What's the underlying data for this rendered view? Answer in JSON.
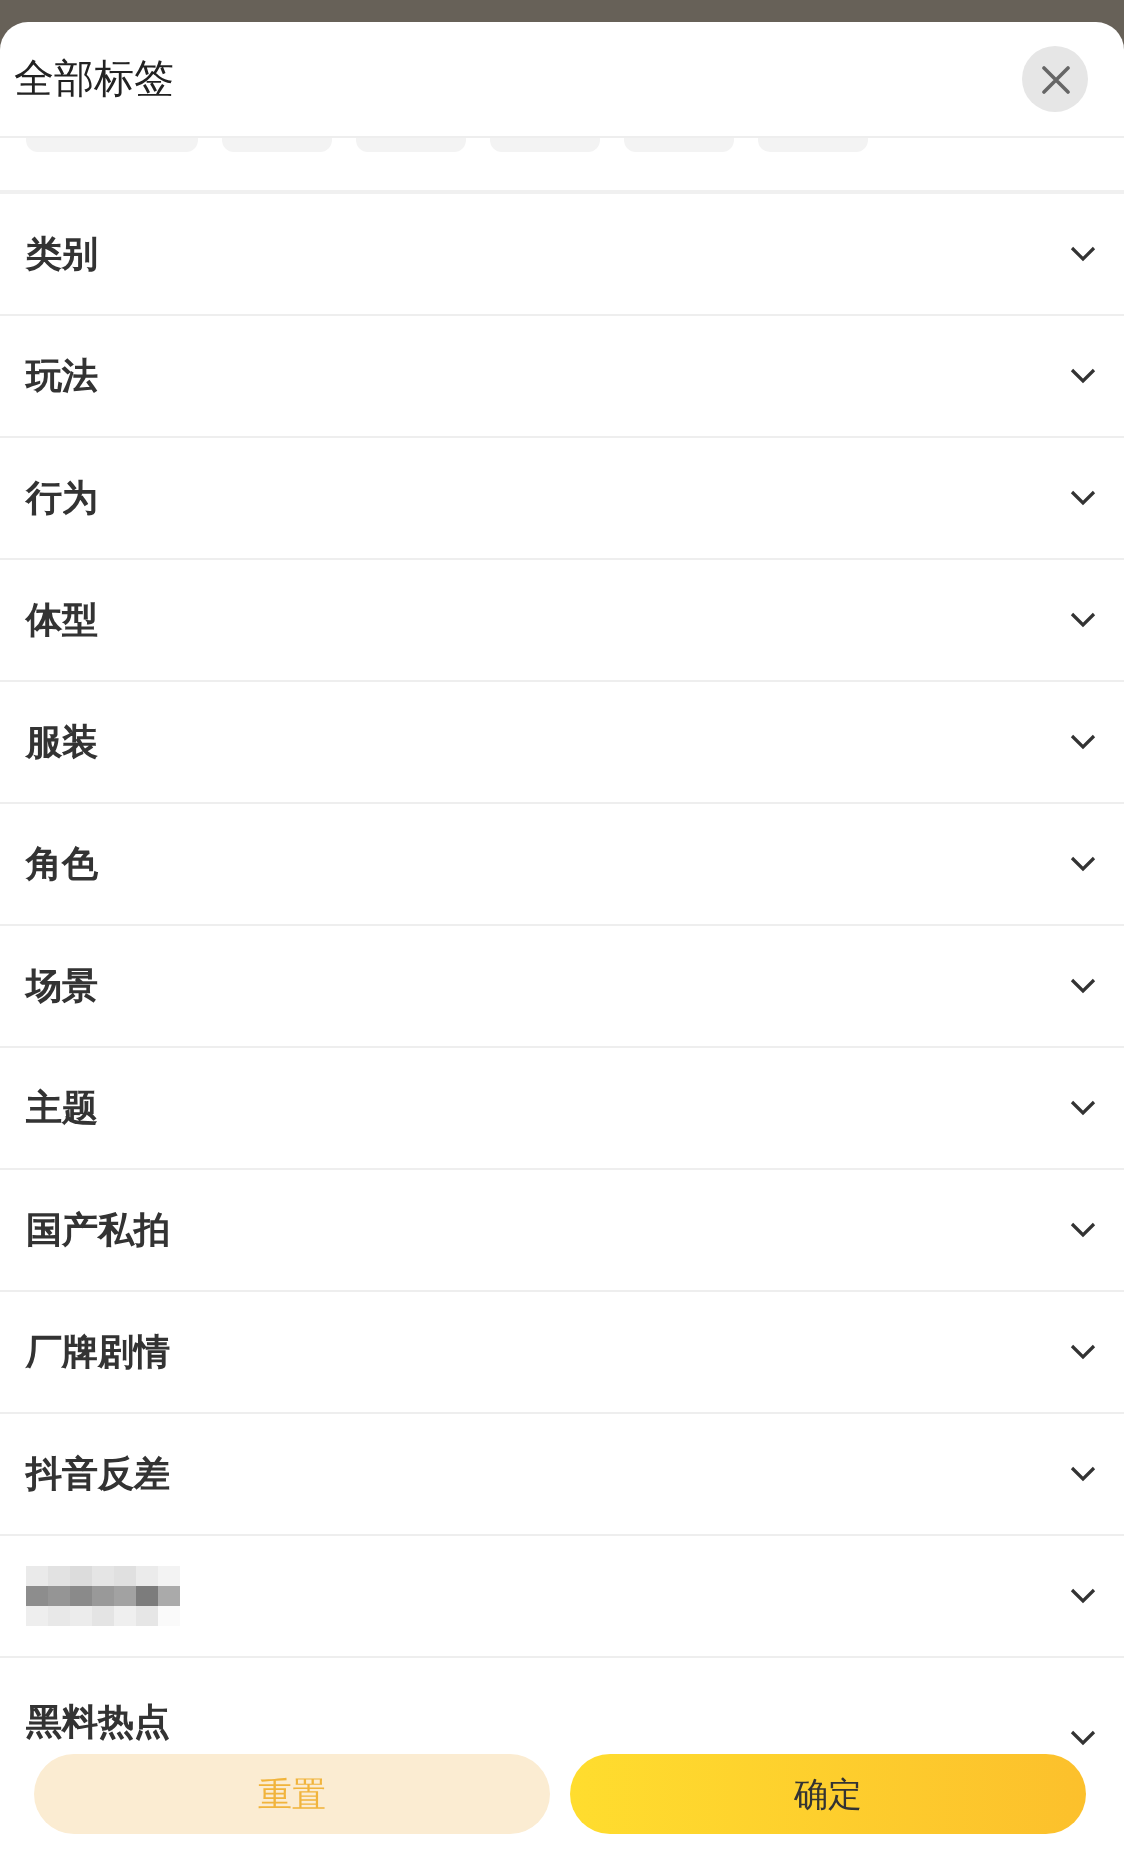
{
  "title": "全部标签",
  "faded_chips": [
    {
      "kind": "chip"
    },
    {
      "kind": "chip"
    },
    {
      "kind": "chip"
    },
    {
      "kind": "chip"
    },
    {
      "kind": "chip"
    },
    {
      "kind": "chip"
    }
  ],
  "categories": [
    {
      "kind": "label",
      "label": "类别",
      "expanded": false
    },
    {
      "kind": "label",
      "label": "玩法",
      "expanded": false
    },
    {
      "kind": "label",
      "label": "行为",
      "expanded": false
    },
    {
      "kind": "label",
      "label": "体型",
      "expanded": false
    },
    {
      "kind": "label",
      "label": "服装",
      "expanded": false
    },
    {
      "kind": "label",
      "label": "角色",
      "expanded": false
    },
    {
      "kind": "label",
      "label": "场景",
      "expanded": false
    },
    {
      "kind": "label",
      "label": "主题",
      "expanded": false
    },
    {
      "kind": "label",
      "label": "国产私拍",
      "expanded": false
    },
    {
      "kind": "label",
      "label": "厂牌剧情",
      "expanded": false
    },
    {
      "kind": "label",
      "label": "抖音反差",
      "expanded": false
    },
    {
      "kind": "pixelated",
      "expanded": false
    },
    {
      "kind": "label",
      "label": "黑料热点",
      "expanded": false
    }
  ],
  "buttons": [
    {
      "kind": "secondary",
      "label": "重置"
    },
    {
      "kind": "primary",
      "label": "确定"
    }
  ]
}
